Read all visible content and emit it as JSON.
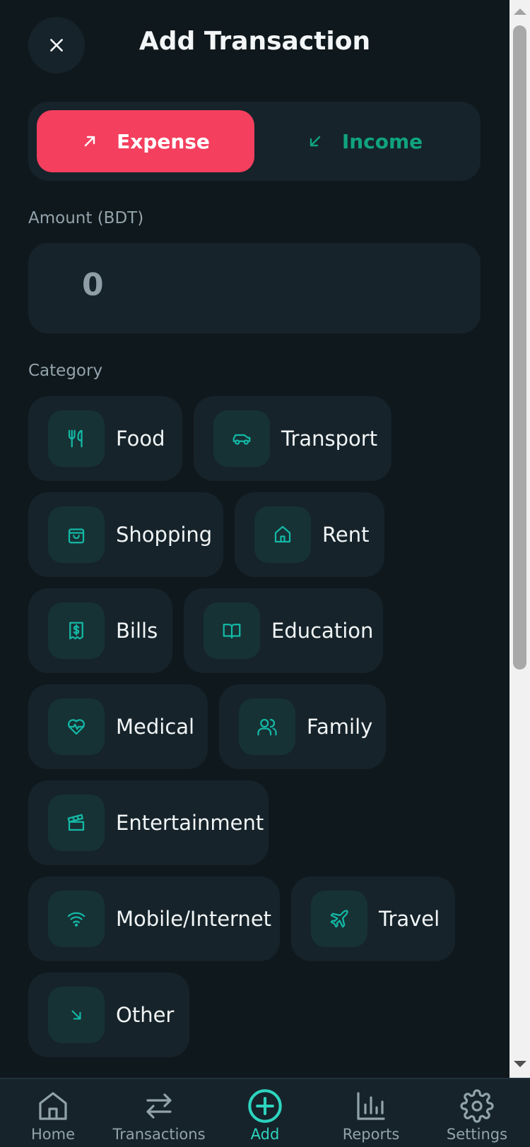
{
  "header": {
    "title": "Add Transaction",
    "close_icon": "close-icon"
  },
  "type_toggle": {
    "expense_label": "Expense",
    "income_label": "Income",
    "selected": "Expense",
    "expense_color": "#f43f5e",
    "income_color": "#10a37f"
  },
  "amount": {
    "label": "Amount (BDT)",
    "value": "0"
  },
  "category": {
    "label": "Category",
    "items": [
      {
        "label": "Food",
        "icon": "utensils-icon"
      },
      {
        "label": "Transport",
        "icon": "car-icon"
      },
      {
        "label": "Shopping",
        "icon": "shopping-bag-icon"
      },
      {
        "label": "Rent",
        "icon": "home-icon"
      },
      {
        "label": "Bills",
        "icon": "receipt-icon"
      },
      {
        "label": "Education",
        "icon": "book-open-icon"
      },
      {
        "label": "Medical",
        "icon": "heart-pulse-icon"
      },
      {
        "label": "Family",
        "icon": "users-icon"
      },
      {
        "label": "Entertainment",
        "icon": "clapperboard-icon"
      },
      {
        "label": "Mobile/Internet",
        "icon": "wifi-icon"
      },
      {
        "label": "Travel",
        "icon": "plane-icon"
      },
      {
        "label": "Other",
        "icon": "arrow-down-right-icon"
      }
    ]
  },
  "bottom_nav": {
    "items": [
      {
        "label": "Home",
        "icon": "home-icon"
      },
      {
        "label": "Transactions",
        "icon": "arrows-swap-icon"
      },
      {
        "label": "Add",
        "icon": "plus-circle-icon"
      },
      {
        "label": "Reports",
        "icon": "bar-chart-icon"
      },
      {
        "label": "Settings",
        "icon": "gear-icon"
      }
    ],
    "active": "Add",
    "accent_color": "#2dd4bf"
  }
}
